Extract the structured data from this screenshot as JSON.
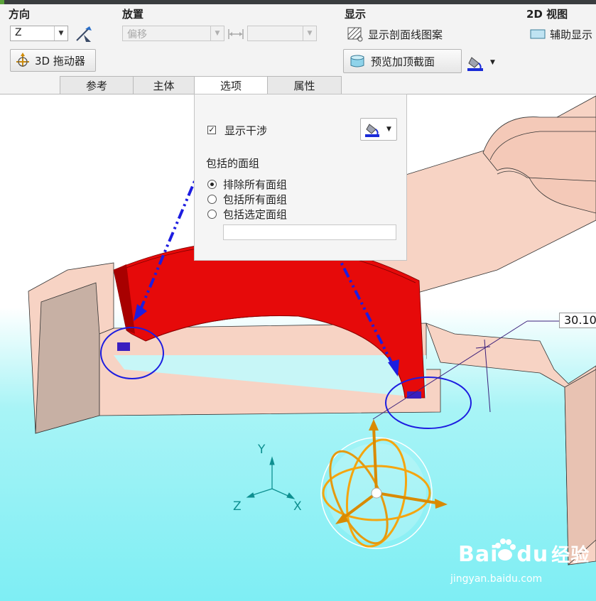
{
  "ribbon": {
    "direction": {
      "title": "方向",
      "axis_value": "Z"
    },
    "placement": {
      "title": "放置",
      "offset_placeholder": "偏移",
      "offset_value": ""
    },
    "display": {
      "title": "显示",
      "hatch_label": "显示剖面线图案",
      "preview_label": "预览加顶截面"
    },
    "view2d": {
      "title": "2D 视图",
      "aux_label": "辅助显示"
    },
    "dragger_label": "3D 拖动器"
  },
  "tabs": [
    {
      "label": "参考",
      "active": false
    },
    {
      "label": "主体",
      "active": false
    },
    {
      "label": "选项",
      "active": true
    },
    {
      "label": "属性",
      "active": false
    }
  ],
  "options_panel": {
    "show_interference_label": "显示干涉",
    "show_interference_checked": true,
    "included_quilts_title": "包括的面组",
    "radio_options": [
      "排除所有面组",
      "包括所有面组",
      "包括选定面组"
    ],
    "selected_radio": 0,
    "quilt_field_value": ""
  },
  "viewport": {
    "dimension_value": "30.10",
    "axes": {
      "x": "X",
      "y": "Y",
      "z": "Z"
    }
  },
  "watermark": {
    "brand_left": "Bai",
    "brand_mid": "du",
    "brand_cn": "经验",
    "url": "jingyan.baidu.com"
  },
  "colors": {
    "model_face": "#f7d3c4",
    "interference_red": "#e60a0a",
    "annotation_blue": "#1d1de0",
    "dragger_orange": "#f5a50f",
    "triad_teal": "#0e8f90"
  },
  "icons": {
    "flip": "diagonal-arrows-icon",
    "dragger": "3d-dragger-icon",
    "hatch": "hatch-pattern-icon",
    "preview": "capped-section-icon",
    "color": "paint-bucket-icon",
    "aux": "aux-display-icon"
  }
}
